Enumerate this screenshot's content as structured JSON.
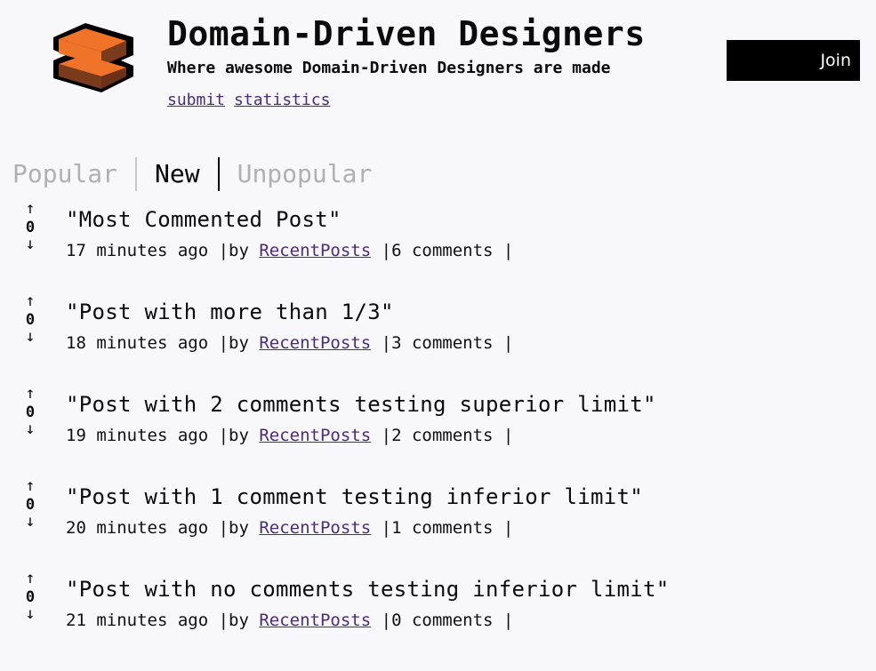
{
  "header": {
    "logo_icon": "brick-logo-icon",
    "title": "Domain-Driven Designers",
    "subtitle": "Where awesome Domain-Driven Designers are made",
    "links": [
      "submit",
      "statistics"
    ],
    "join_label": "Join"
  },
  "tabs": [
    {
      "label": "Popular",
      "active": false
    },
    {
      "label": "New",
      "active": true
    },
    {
      "label": "Unpopular",
      "active": false
    }
  ],
  "colors": {
    "background": "#f8f8fa",
    "link": "#4d2b7a",
    "tab_inactive": "#b0b0b0",
    "logo_orange": "#f0732a",
    "logo_brown": "#7a3a1c"
  },
  "posts": [
    {
      "up_icon": "arrow-up-icon",
      "score": "0",
      "down_icon": "arrow-down-icon",
      "title": "\"Most Commented Post\"",
      "time": "17 minutes ago |by ",
      "author": "RecentPosts",
      "comments": " |6 comments |"
    },
    {
      "up_icon": "arrow-up-icon",
      "score": "0",
      "down_icon": "arrow-down-icon",
      "title": "\"Post with more than 1/3\"",
      "time": "18 minutes ago |by ",
      "author": "RecentPosts",
      "comments": " |3 comments |"
    },
    {
      "up_icon": "arrow-up-icon",
      "score": "0",
      "down_icon": "arrow-down-icon",
      "title": "\"Post with 2 comments testing superior limit\"",
      "time": "19 minutes ago |by ",
      "author": "RecentPosts",
      "comments": " |2 comments |"
    },
    {
      "up_icon": "arrow-up-icon",
      "score": "0",
      "down_icon": "arrow-down-icon",
      "title": "\"Post with 1 comment testing inferior limit\"",
      "time": "20 minutes ago |by ",
      "author": "RecentPosts",
      "comments": " |1 comments |"
    },
    {
      "up_icon": "arrow-up-icon",
      "score": "0",
      "down_icon": "arrow-down-icon",
      "title": "\"Post with no comments testing inferior limit\"",
      "time": "21 minutes ago |by ",
      "author": "RecentPosts",
      "comments": " |0 comments |"
    }
  ]
}
